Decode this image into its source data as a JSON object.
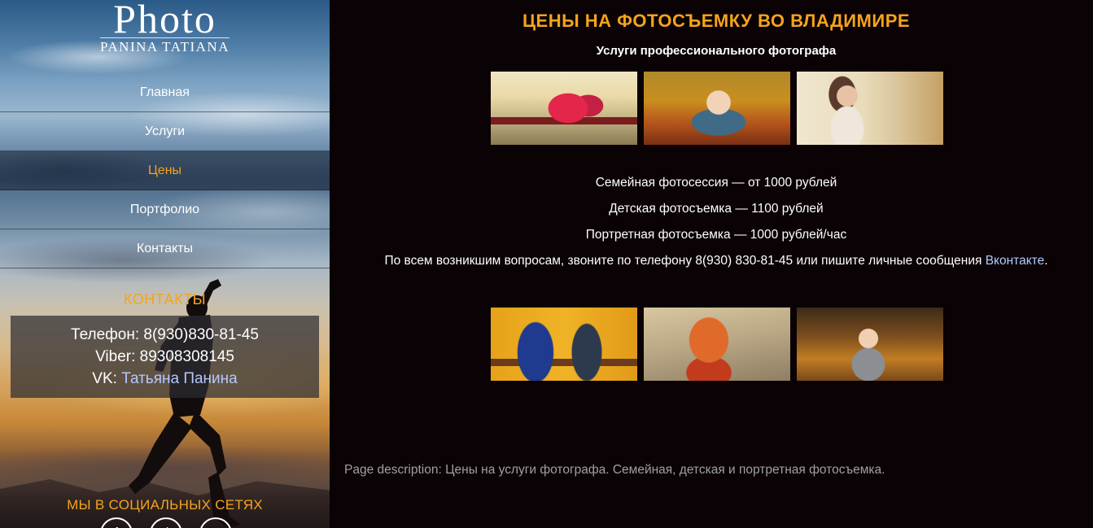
{
  "logo": {
    "title": "Photo",
    "subtitle": "PANINA TATIANA"
  },
  "nav": {
    "items": [
      {
        "label": "Главная"
      },
      {
        "label": "Услуги"
      },
      {
        "label": "Цены",
        "active": true
      },
      {
        "label": "Портфолио"
      },
      {
        "label": "Контакты"
      }
    ]
  },
  "contacts": {
    "title": "КОНТАКТЫ",
    "phone": "Телефон: 8(930)830-81-45",
    "viber": "Viber: 89308308145",
    "vk_prefix": "VK:",
    "vk_link": "Татьяна Панина"
  },
  "social": {
    "title": "МЫ В СОЦИАЛЬНЫХ СЕТЯХ",
    "icons": [
      "facebook-icon",
      "vk-icon",
      "instagram-icon"
    ]
  },
  "main": {
    "title": "ЦЕНЫ НА ФОТОСЪЕМКУ ВО ВЛАДИМИРЕ",
    "subtitle": "Услуги профессионального фотографа",
    "prices": [
      "Семейная фотосессия — от 1000 рублей",
      "Детская фотосъемка — 1100 рублей",
      "Портретная фотосъемка — 1000 рублей/час"
    ],
    "contact_note": "По всем возникшим вопросам, звоните по телефону 8(930) 830-81-45 или пишите личные сообщения",
    "contact_link": "Вконтакте",
    "contact_tail": ".",
    "page_description": "Page description: Цены на услуги фотографа. Семейная, детская и портретная фотосъемка."
  },
  "colors": {
    "accent": "#f6a31d",
    "link": "#b4c8ff",
    "background": "#0a0204"
  }
}
